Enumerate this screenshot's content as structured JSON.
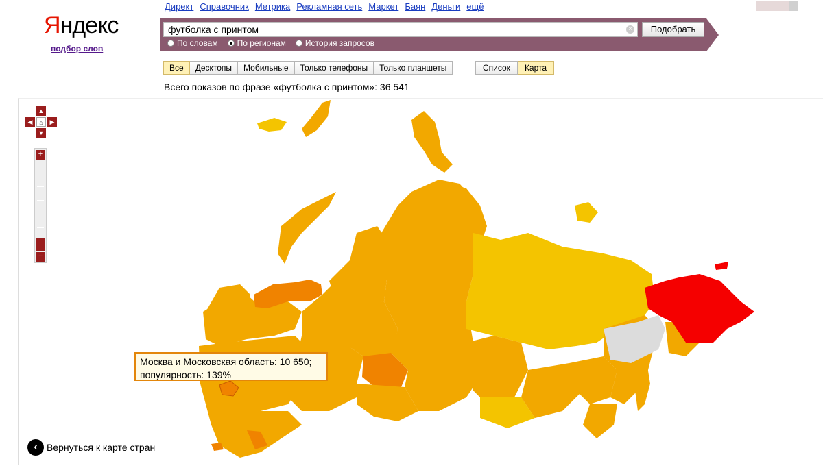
{
  "logo": {
    "first_letter": "Я",
    "rest": "ндекс",
    "subtitle": "подбор слов"
  },
  "services": [
    "Директ",
    "Справочник",
    "Метрика",
    "Рекламная сеть",
    "Маркет",
    "Баян",
    "Деньги",
    "ещё"
  ],
  "search": {
    "value": "футболка с принтом",
    "button": "Подобрать",
    "clear_icon": "×"
  },
  "modes": [
    {
      "label": "По словам",
      "selected": false
    },
    {
      "label": "По регионам",
      "selected": true
    },
    {
      "label": "История запросов",
      "selected": false
    }
  ],
  "device_filters": [
    {
      "label": "Все",
      "selected": true
    },
    {
      "label": "Десктопы",
      "selected": false
    },
    {
      "label": "Мобильные",
      "selected": false
    },
    {
      "label": "Только телефоны",
      "selected": false
    },
    {
      "label": "Только планшеты",
      "selected": false
    }
  ],
  "view_toggle": [
    {
      "label": "Список",
      "selected": false
    },
    {
      "label": "Карта",
      "selected": true
    }
  ],
  "summary": "Всего показов по фразе «футболка с принтом»: 36 541",
  "map": {
    "nav": {
      "up": "▲",
      "down": "▼",
      "left": "◀",
      "right": "▶",
      "home": "⌂"
    },
    "zoom": {
      "in": "+",
      "out": "−"
    },
    "tooltip_line1": "Москва и Московская область: 10 650;",
    "tooltip_line2": "популярность: 139%",
    "colors": {
      "high": "#f50000",
      "mid_high": "#f08300",
      "mid": "#f2a800",
      "low": "#f4c400",
      "none": "#dcdcdc"
    }
  },
  "back_link": {
    "label": "Вернуться к карте стран",
    "icon": "back-arrow-icon"
  }
}
